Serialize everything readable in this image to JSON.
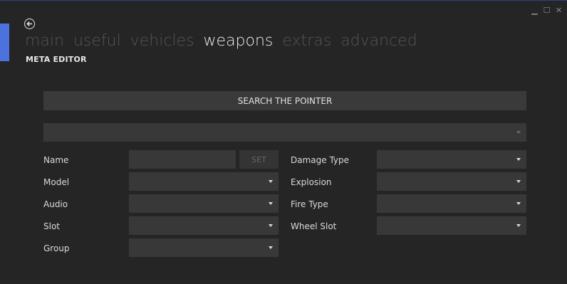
{
  "window": {
    "minimize_glyph": "▁",
    "maximize_glyph": "☐",
    "close_glyph": "✕"
  },
  "header": {
    "back_icon": "back-arrow-icon",
    "tabs": [
      {
        "label": "main",
        "active": false
      },
      {
        "label": "useful",
        "active": false
      },
      {
        "label": "vehicles",
        "active": false
      },
      {
        "label": "weapons",
        "active": true
      },
      {
        "label": "extras",
        "active": false
      },
      {
        "label": "advanced",
        "active": false
      }
    ],
    "subtitle": "META EDITOR"
  },
  "editor": {
    "search_label": "SEARCH THE POINTER",
    "pointer_select_value": "",
    "set_label": "SET",
    "fields_left": [
      {
        "label": "Name",
        "value": ""
      },
      {
        "label": "Model",
        "value": ""
      },
      {
        "label": "Audio",
        "value": ""
      },
      {
        "label": "Slot",
        "value": ""
      },
      {
        "label": "Group",
        "value": ""
      }
    ],
    "fields_right": [
      {
        "label": "Damage Type",
        "value": ""
      },
      {
        "label": "Explosion",
        "value": ""
      },
      {
        "label": "Fire Type",
        "value": ""
      },
      {
        "label": "Wheel Slot",
        "value": ""
      }
    ]
  },
  "colors": {
    "background": "#252525",
    "accent": "#4c72e0",
    "control": "#383838"
  }
}
